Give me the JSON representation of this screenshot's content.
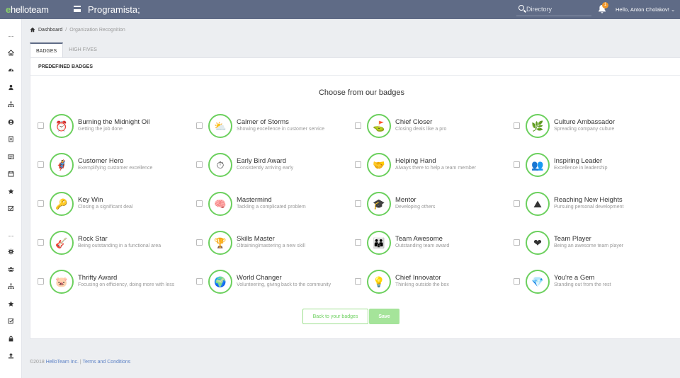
{
  "header": {
    "logo_prefix": "e",
    "logo_text": "helloteam",
    "app_title": "Programista;",
    "search_placeholder": "Directory",
    "notification_count": "1",
    "user_greeting": "Hello, Anton Cholakov!"
  },
  "sidebar": {
    "top_dots": "...",
    "mid_dots": "...",
    "items_top": [
      "home-icon",
      "dashboard-icon",
      "user-icon",
      "org-chart-icon",
      "user-circle-icon",
      "document-icon",
      "newspaper-icon",
      "calendar-icon",
      "star-icon",
      "checkbox-icon"
    ],
    "items_bottom": [
      "gear-icon",
      "users-icon",
      "org-chart-icon",
      "star-icon",
      "checkbox-icon",
      "lock-icon",
      "upload-icon"
    ]
  },
  "breadcrumb": {
    "home": "Dashboard",
    "separator": "/",
    "current": "Organization Recognition"
  },
  "tabs": [
    "BADGES",
    "HIGH FIVES"
  ],
  "card": {
    "header": "PREDEFINED BADGES",
    "choose_title": "Choose from our badges"
  },
  "badges": [
    {
      "name": "Burning the Midnight Oil",
      "desc": "Getting the job done",
      "icon": "⏰"
    },
    {
      "name": "Calmer of Storms",
      "desc": "Showing excellence in customer service",
      "icon": "⛅"
    },
    {
      "name": "Chief Closer",
      "desc": "Closing deals like a pro",
      "icon": "⛳"
    },
    {
      "name": "Culture Ambassador",
      "desc": "Spreading company culture",
      "icon": "🌿"
    },
    {
      "name": "Customer Hero",
      "desc": "Exemplifying customer excellence",
      "icon": "🦸"
    },
    {
      "name": "Early Bird Award",
      "desc": "Consistently arriving early",
      "icon": "⏱"
    },
    {
      "name": "Helping Hand",
      "desc": "Always there to help a team member",
      "icon": "🤝"
    },
    {
      "name": "Inspiring Leader",
      "desc": "Excellence in leadership",
      "icon": "👥"
    },
    {
      "name": "Key Win",
      "desc": "Closing a significant deal",
      "icon": "🔑"
    },
    {
      "name": "Mastermind",
      "desc": "Tackling a complicated problem",
      "icon": "🧠"
    },
    {
      "name": "Mentor",
      "desc": "Developing others",
      "icon": "🎓"
    },
    {
      "name": "Reaching New Heights",
      "desc": "Pursuing personal development",
      "icon": "⛰"
    },
    {
      "name": "Rock Star",
      "desc": "Being outstanding in a functional area",
      "icon": "🎸"
    },
    {
      "name": "Skills Master",
      "desc": "Obtaining/mastering a new skill",
      "icon": "🏆"
    },
    {
      "name": "Team Awesome",
      "desc": "Outstanding team award",
      "icon": "👪"
    },
    {
      "name": "Team Player",
      "desc": "Being an awesome team player",
      "icon": "❤"
    },
    {
      "name": "Thrifty Award",
      "desc": "Focusing on efficiency, doing more with less",
      "icon": "🐷"
    },
    {
      "name": "World Changer",
      "desc": "Volunteering, giving back to the community",
      "icon": "🌍"
    },
    {
      "name": "Chief Innovator",
      "desc": "Thinking outside the box",
      "icon": "💡"
    },
    {
      "name": "You're a Gem",
      "desc": "Standing out from the rest",
      "icon": "💎"
    }
  ],
  "buttons": {
    "back": "Back to your badges",
    "save": "Save"
  },
  "footer": {
    "copyright": "©2018",
    "company": "HelloTeam Inc.",
    "separator": " | ",
    "terms": "Terms and Conditions"
  },
  "colors": {
    "topbar": "#5f6b86",
    "accent_green": "#6cd05e",
    "link_blue": "#5b80c5"
  }
}
